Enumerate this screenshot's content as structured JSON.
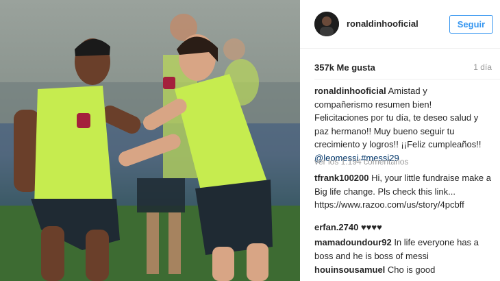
{
  "post": {
    "author": "ronaldinhooficial",
    "follow_label": "Seguir",
    "likes": "357k Me gusta",
    "age": "1 día"
  },
  "caption": {
    "author": "ronaldinhooficial",
    "text": "Amistad y compañerismo resumen bien! Felicitaciones por tu día, te deseo salud y paz hermano!! Muy bueno seguir tu crecimiento y logros!! ¡¡Feliz cumpleaños!! ",
    "mention": "@leomessi",
    "hashtag": "#messi29"
  },
  "view_comments": "ver los 1.194 comentarios",
  "comments": [
    {
      "user": "tfrank100200",
      "text": "Hi, your little fundraise make a Big life change. Pls check this link... https://www.razoo.com/us/story/4pcbff"
    },
    {
      "user": "erfan.2740",
      "text": "♥♥♥♥"
    },
    {
      "user": "mamadoundour92",
      "text": "In life everyone has a boss and he is boss of messi"
    },
    {
      "user": "houinsousamuel",
      "text": "Cho is good"
    }
  ],
  "colors": {
    "accent": "#3897f0",
    "jersey": "#c6ec4f",
    "shorts": "#1f2a33"
  },
  "icons": {
    "avatar": "profile-photo"
  }
}
